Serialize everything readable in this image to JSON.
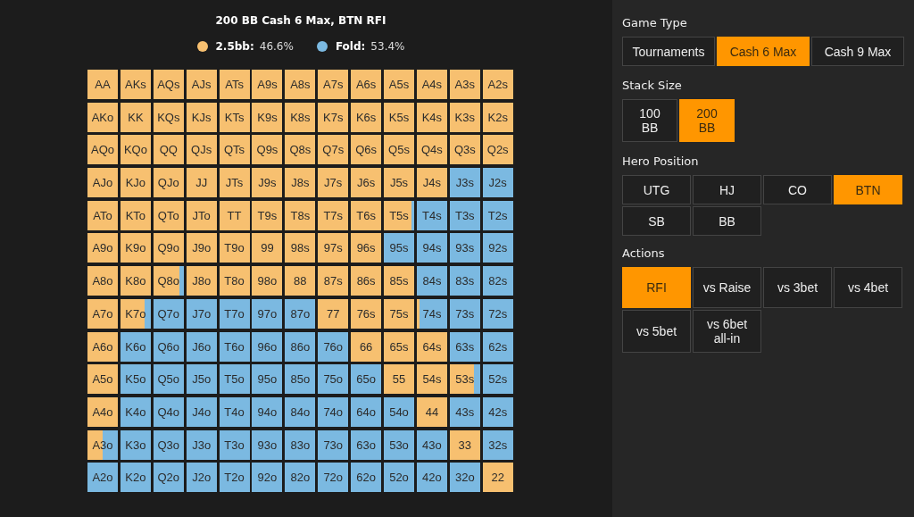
{
  "chart_title": "200 BB Cash 6 Max, BTN RFI",
  "legend": [
    {
      "label": "2.5bb:",
      "value": "46.6%",
      "color": "#f7c070"
    },
    {
      "label": "Fold:",
      "value": "53.4%",
      "color": "#7bb9e1"
    }
  ],
  "grid": {
    "rows": [
      [
        {
          "hand": "AA",
          "kind": "raise"
        },
        {
          "hand": "AKs",
          "kind": "raise"
        },
        {
          "hand": "AQs",
          "kind": "raise"
        },
        {
          "hand": "AJs",
          "kind": "raise"
        },
        {
          "hand": "ATs",
          "kind": "raise"
        },
        {
          "hand": "A9s",
          "kind": "raise"
        },
        {
          "hand": "A8s",
          "kind": "raise"
        },
        {
          "hand": "A7s",
          "kind": "raise"
        },
        {
          "hand": "A6s",
          "kind": "raise"
        },
        {
          "hand": "A5s",
          "kind": "raise"
        },
        {
          "hand": "A4s",
          "kind": "raise"
        },
        {
          "hand": "A3s",
          "kind": "raise"
        },
        {
          "hand": "A2s",
          "kind": "raise"
        }
      ],
      [
        {
          "hand": "AKo",
          "kind": "raise"
        },
        {
          "hand": "KK",
          "kind": "raise"
        },
        {
          "hand": "KQs",
          "kind": "raise"
        },
        {
          "hand": "KJs",
          "kind": "raise"
        },
        {
          "hand": "KTs",
          "kind": "raise"
        },
        {
          "hand": "K9s",
          "kind": "raise"
        },
        {
          "hand": "K8s",
          "kind": "raise"
        },
        {
          "hand": "K7s",
          "kind": "raise"
        },
        {
          "hand": "K6s",
          "kind": "raise"
        },
        {
          "hand": "K5s",
          "kind": "raise"
        },
        {
          "hand": "K4s",
          "kind": "raise"
        },
        {
          "hand": "K3s",
          "kind": "raise"
        },
        {
          "hand": "K2s",
          "kind": "raise"
        }
      ],
      [
        {
          "hand": "AQo",
          "kind": "raise"
        },
        {
          "hand": "KQo",
          "kind": "raise"
        },
        {
          "hand": "QQ",
          "kind": "raise"
        },
        {
          "hand": "QJs",
          "kind": "raise"
        },
        {
          "hand": "QTs",
          "kind": "raise"
        },
        {
          "hand": "Q9s",
          "kind": "raise"
        },
        {
          "hand": "Q8s",
          "kind": "raise"
        },
        {
          "hand": "Q7s",
          "kind": "raise"
        },
        {
          "hand": "Q6s",
          "kind": "raise"
        },
        {
          "hand": "Q5s",
          "kind": "raise"
        },
        {
          "hand": "Q4s",
          "kind": "raise"
        },
        {
          "hand": "Q3s",
          "kind": "raise"
        },
        {
          "hand": "Q2s",
          "kind": "raise"
        }
      ],
      [
        {
          "hand": "AJo",
          "kind": "raise"
        },
        {
          "hand": "KJo",
          "kind": "raise"
        },
        {
          "hand": "QJo",
          "kind": "raise"
        },
        {
          "hand": "JJ",
          "kind": "raise"
        },
        {
          "hand": "JTs",
          "kind": "raise"
        },
        {
          "hand": "J9s",
          "kind": "raise"
        },
        {
          "hand": "J8s",
          "kind": "raise"
        },
        {
          "hand": "J7s",
          "kind": "raise"
        },
        {
          "hand": "J6s",
          "kind": "raise"
        },
        {
          "hand": "J5s",
          "kind": "raise"
        },
        {
          "hand": "J4s",
          "kind": "raise"
        },
        {
          "hand": "J3s",
          "kind": "fold"
        },
        {
          "hand": "J2s",
          "kind": "fold"
        }
      ],
      [
        {
          "hand": "ATo",
          "kind": "raise"
        },
        {
          "hand": "KTo",
          "kind": "raise"
        },
        {
          "hand": "QTo",
          "kind": "raise"
        },
        {
          "hand": "JTo",
          "kind": "raise"
        },
        {
          "hand": "TT",
          "kind": "raise"
        },
        {
          "hand": "T9s",
          "kind": "raise"
        },
        {
          "hand": "T8s",
          "kind": "raise"
        },
        {
          "hand": "T7s",
          "kind": "raise"
        },
        {
          "hand": "T6s",
          "kind": "raise"
        },
        {
          "hand": "T5s",
          "kind": "mixed",
          "level": 0.9
        },
        {
          "hand": "T4s",
          "kind": "fold"
        },
        {
          "hand": "T3s",
          "kind": "fold"
        },
        {
          "hand": "T2s",
          "kind": "fold"
        }
      ],
      [
        {
          "hand": "A9o",
          "kind": "raise"
        },
        {
          "hand": "K9o",
          "kind": "raise"
        },
        {
          "hand": "Q9o",
          "kind": "raise"
        },
        {
          "hand": "J9o",
          "kind": "raise"
        },
        {
          "hand": "T9o",
          "kind": "raise"
        },
        {
          "hand": "99",
          "kind": "raise"
        },
        {
          "hand": "98s",
          "kind": "raise"
        },
        {
          "hand": "97s",
          "kind": "raise"
        },
        {
          "hand": "96s",
          "kind": "raise"
        },
        {
          "hand": "95s",
          "kind": "fold"
        },
        {
          "hand": "94s",
          "kind": "fold"
        },
        {
          "hand": "93s",
          "kind": "fold"
        },
        {
          "hand": "92s",
          "kind": "fold"
        }
      ],
      [
        {
          "hand": "A8o",
          "kind": "raise"
        },
        {
          "hand": "K8o",
          "kind": "raise"
        },
        {
          "hand": "Q8o",
          "kind": "mixed",
          "level": 0.85
        },
        {
          "hand": "J8o",
          "kind": "raise"
        },
        {
          "hand": "T8o",
          "kind": "raise"
        },
        {
          "hand": "98o",
          "kind": "raise"
        },
        {
          "hand": "88",
          "kind": "raise"
        },
        {
          "hand": "87s",
          "kind": "raise"
        },
        {
          "hand": "86s",
          "kind": "raise"
        },
        {
          "hand": "85s",
          "kind": "raise"
        },
        {
          "hand": "84s",
          "kind": "fold"
        },
        {
          "hand": "83s",
          "kind": "fold"
        },
        {
          "hand": "82s",
          "kind": "fold"
        }
      ],
      [
        {
          "hand": "A7o",
          "kind": "raise"
        },
        {
          "hand": "K7o",
          "kind": "mixed",
          "level": 0.8
        },
        {
          "hand": "Q7o",
          "kind": "fold"
        },
        {
          "hand": "J7o",
          "kind": "fold"
        },
        {
          "hand": "T7o",
          "kind": "fold"
        },
        {
          "hand": "97o",
          "kind": "fold"
        },
        {
          "hand": "87o",
          "kind": "fold"
        },
        {
          "hand": "77",
          "kind": "raise"
        },
        {
          "hand": "76s",
          "kind": "raise"
        },
        {
          "hand": "75s",
          "kind": "raise"
        },
        {
          "hand": "74s",
          "kind": "mixed",
          "level": 0.1
        },
        {
          "hand": "73s",
          "kind": "fold"
        },
        {
          "hand": "72s",
          "kind": "fold"
        }
      ],
      [
        {
          "hand": "A6o",
          "kind": "raise"
        },
        {
          "hand": "K6o",
          "kind": "fold"
        },
        {
          "hand": "Q6o",
          "kind": "fold"
        },
        {
          "hand": "J6o",
          "kind": "fold"
        },
        {
          "hand": "T6o",
          "kind": "fold"
        },
        {
          "hand": "96o",
          "kind": "fold"
        },
        {
          "hand": "86o",
          "kind": "fold"
        },
        {
          "hand": "76o",
          "kind": "fold"
        },
        {
          "hand": "66",
          "kind": "raise"
        },
        {
          "hand": "65s",
          "kind": "raise"
        },
        {
          "hand": "64s",
          "kind": "raise"
        },
        {
          "hand": "63s",
          "kind": "fold"
        },
        {
          "hand": "62s",
          "kind": "fold"
        }
      ],
      [
        {
          "hand": "A5o",
          "kind": "raise"
        },
        {
          "hand": "K5o",
          "kind": "fold"
        },
        {
          "hand": "Q5o",
          "kind": "fold"
        },
        {
          "hand": "J5o",
          "kind": "fold"
        },
        {
          "hand": "T5o",
          "kind": "fold"
        },
        {
          "hand": "95o",
          "kind": "fold"
        },
        {
          "hand": "85o",
          "kind": "fold"
        },
        {
          "hand": "75o",
          "kind": "fold"
        },
        {
          "hand": "65o",
          "kind": "fold"
        },
        {
          "hand": "55",
          "kind": "raise"
        },
        {
          "hand": "54s",
          "kind": "raise"
        },
        {
          "hand": "53s",
          "kind": "mixed",
          "level": 0.8
        },
        {
          "hand": "52s",
          "kind": "fold"
        }
      ],
      [
        {
          "hand": "A4o",
          "kind": "raise"
        },
        {
          "hand": "K4o",
          "kind": "fold"
        },
        {
          "hand": "Q4o",
          "kind": "fold"
        },
        {
          "hand": "J4o",
          "kind": "fold"
        },
        {
          "hand": "T4o",
          "kind": "fold"
        },
        {
          "hand": "94o",
          "kind": "fold"
        },
        {
          "hand": "84o",
          "kind": "fold"
        },
        {
          "hand": "74o",
          "kind": "fold"
        },
        {
          "hand": "64o",
          "kind": "fold"
        },
        {
          "hand": "54o",
          "kind": "fold"
        },
        {
          "hand": "44",
          "kind": "raise"
        },
        {
          "hand": "43s",
          "kind": "fold"
        },
        {
          "hand": "42s",
          "kind": "fold"
        }
      ],
      [
        {
          "hand": "A3o",
          "kind": "mixed",
          "level": 0.5
        },
        {
          "hand": "K3o",
          "kind": "fold"
        },
        {
          "hand": "Q3o",
          "kind": "fold"
        },
        {
          "hand": "J3o",
          "kind": "fold"
        },
        {
          "hand": "T3o",
          "kind": "fold"
        },
        {
          "hand": "93o",
          "kind": "fold"
        },
        {
          "hand": "83o",
          "kind": "fold"
        },
        {
          "hand": "73o",
          "kind": "fold"
        },
        {
          "hand": "63o",
          "kind": "fold"
        },
        {
          "hand": "53o",
          "kind": "fold"
        },
        {
          "hand": "43o",
          "kind": "fold"
        },
        {
          "hand": "33",
          "kind": "raise"
        },
        {
          "hand": "32s",
          "kind": "fold"
        }
      ],
      [
        {
          "hand": "A2o",
          "kind": "fold"
        },
        {
          "hand": "K2o",
          "kind": "fold"
        },
        {
          "hand": "Q2o",
          "kind": "fold"
        },
        {
          "hand": "J2o",
          "kind": "fold"
        },
        {
          "hand": "T2o",
          "kind": "fold"
        },
        {
          "hand": "92o",
          "kind": "fold"
        },
        {
          "hand": "82o",
          "kind": "fold"
        },
        {
          "hand": "72o",
          "kind": "fold"
        },
        {
          "hand": "62o",
          "kind": "fold"
        },
        {
          "hand": "52o",
          "kind": "fold"
        },
        {
          "hand": "42o",
          "kind": "fold"
        },
        {
          "hand": "32o",
          "kind": "fold"
        },
        {
          "hand": "22",
          "kind": "raise"
        }
      ]
    ]
  },
  "sidebar": {
    "sections": [
      {
        "heading": "Game Type",
        "kind": "wide",
        "options": [
          {
            "label": "Tournaments",
            "selected": false
          },
          {
            "label": "Cash 6 Max",
            "selected": true
          },
          {
            "label": "Cash 9 Max",
            "selected": false
          }
        ]
      },
      {
        "heading": "Stack Size",
        "kind": "narrow",
        "options": [
          {
            "label": "100 BB",
            "selected": false
          },
          {
            "label": "200 BB",
            "selected": true
          }
        ]
      },
      {
        "heading": "Hero Position",
        "kind": "quad",
        "options": [
          {
            "label": "UTG",
            "selected": false
          },
          {
            "label": "HJ",
            "selected": false
          },
          {
            "label": "CO",
            "selected": false
          },
          {
            "label": "BTN",
            "selected": true
          },
          {
            "label": "SB",
            "selected": false
          },
          {
            "label": "BB",
            "selected": false
          }
        ]
      },
      {
        "heading": "Actions",
        "kind": "quad",
        "options": [
          {
            "label": "RFI",
            "selected": true
          },
          {
            "label": "vs Raise",
            "selected": false
          },
          {
            "label": "vs 3bet",
            "selected": false
          },
          {
            "label": "vs 4bet",
            "selected": false
          },
          {
            "label": "vs 5bet",
            "selected": false
          },
          {
            "label": "vs 6bet all-in",
            "selected": false
          }
        ]
      }
    ]
  }
}
